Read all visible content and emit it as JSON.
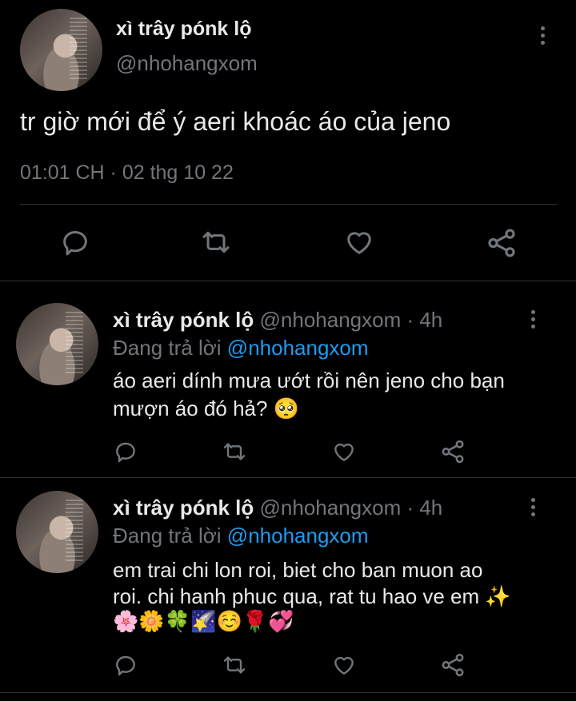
{
  "main_tweet": {
    "display_name": "xì trây pónk lộ",
    "handle": "@nhohangxom",
    "text": "tr giờ mới để ý aeri khoác áo của jeno",
    "timestamp": "01:01 CH · 02 thg 10 22",
    "icons": [
      "reply-icon",
      "retweet-icon",
      "like-icon",
      "share-icon"
    ]
  },
  "replies": [
    {
      "display_name": "xì trây pónk lộ",
      "handle": "@nhohangxom",
      "time": "· 4h",
      "replying_prefix": "Đang trả lời",
      "replying_to": "@nhohangxom",
      "text_lines": [
        "áo aeri dính mưa ướt rồi nên jeno cho bạn",
        "mượn áo đó hả? 🥺"
      ]
    },
    {
      "display_name": "xì trây pónk lộ",
      "handle": "@nhohangxom",
      "time": "· 4h",
      "replying_prefix": "Đang trả lời",
      "replying_to": "@nhohangxom",
      "text_lines": [
        "em trai chi lon roi, biet cho ban muon ao",
        "roi. chi hanh phuc qua, rat tu hao ve em ✨",
        "🌸🌼🍀🌠☺️🌹💞"
      ]
    }
  ]
}
